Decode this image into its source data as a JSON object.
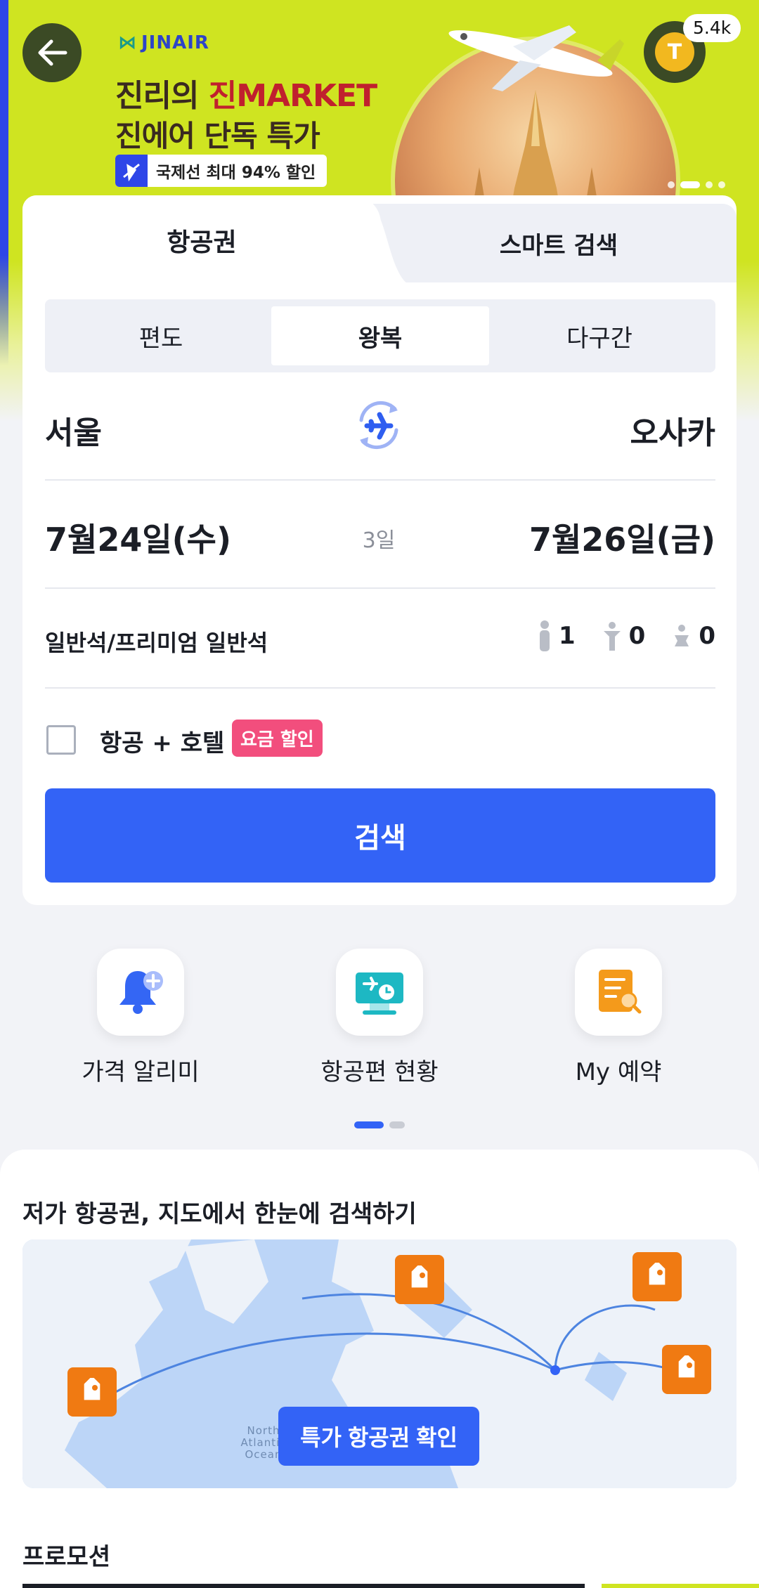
{
  "banner": {
    "brand": "JINAIR",
    "title_line1_a": "진리의 ",
    "title_line1_b": "진MARKET",
    "title_line2": "진에어 단독 특가",
    "pill_prefix": "국제선 최대 ",
    "pill_highlight": "94%",
    "pill_suffix": " 할인",
    "coin_letter": "T",
    "coin_count": "5.4k"
  },
  "tabs": {
    "flight": "항공권",
    "smart": "스마트 검색"
  },
  "trip_types": [
    "편도",
    "왕복",
    "다구간"
  ],
  "selected_trip_type": "왕복",
  "route": {
    "origin": "서울",
    "destination": "오사카"
  },
  "dates": {
    "depart": "7월24일(수)",
    "return": "7월26일(금)",
    "nights": "3일"
  },
  "cabin": "일반석/프리미엄 일반석",
  "passengers": {
    "adult": "1",
    "child": "0",
    "infant": "0"
  },
  "bundle": {
    "label": "항공 + 호텔",
    "badge": "요금 할인",
    "checked": false
  },
  "search_button": "검색",
  "quick_menu": [
    {
      "label": "가격 알리미",
      "icon": "bell-icon"
    },
    {
      "label": "항공편 현황",
      "icon": "flight-status-icon"
    },
    {
      "label": "My 예약",
      "icon": "reservation-search-icon"
    }
  ],
  "map_section": {
    "title": "저가 항공권, 지도에서 한눈에 검색하기",
    "button": "특가 항공권 확인",
    "ocean_label_1": "North",
    "ocean_label_2": "Atlantic",
    "ocean_label_3": "Ocean"
  },
  "promotion_title": "프로모션",
  "colors": {
    "accent": "#3363f6",
    "banner": "#cfe421",
    "pink": "#f24e7d",
    "tag": "#f07a12"
  }
}
